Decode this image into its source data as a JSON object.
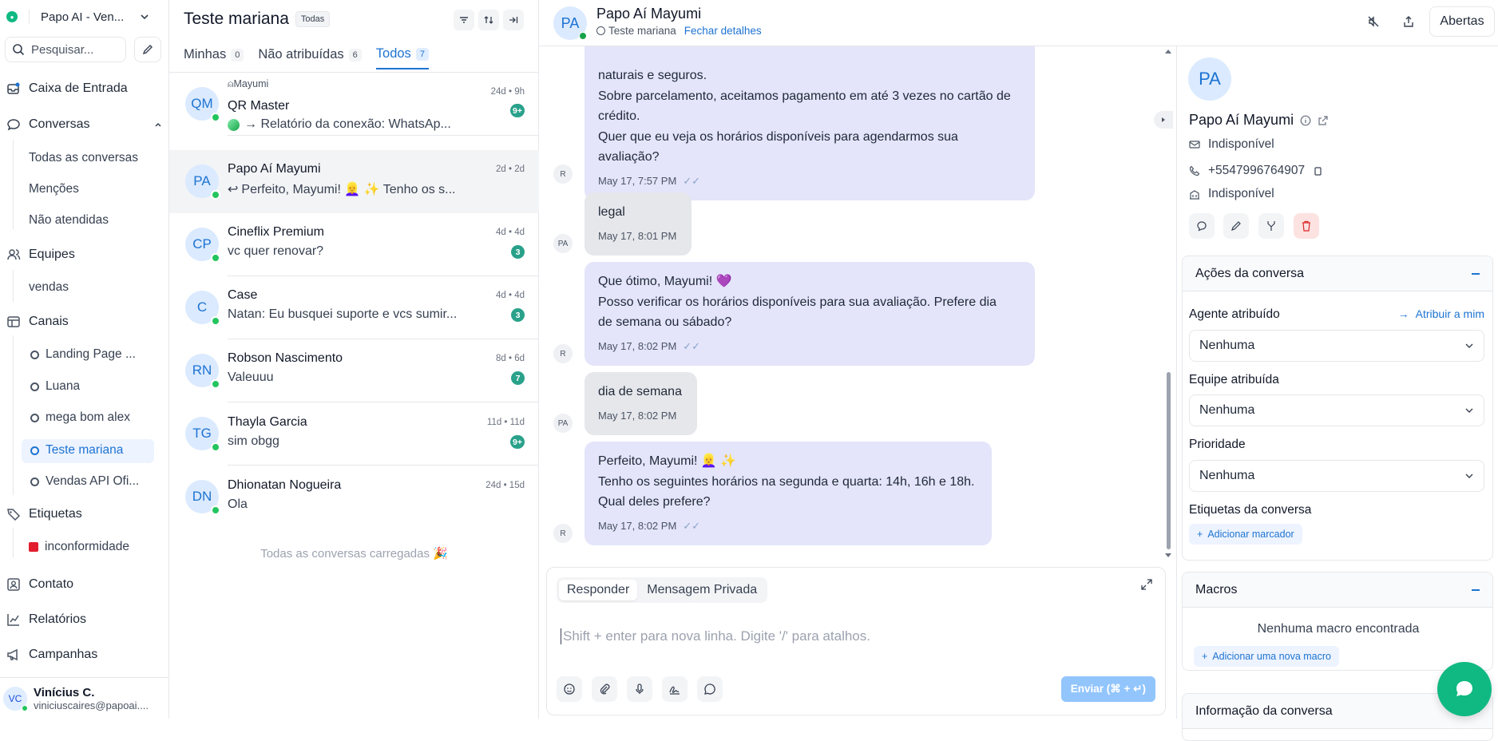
{
  "sidebar": {
    "workspace": "Papo AI - Ven...",
    "search_placeholder": "Pesquisar...",
    "nav": {
      "inbox": "Caixa de Entrada",
      "conversations": "Conversas",
      "all_conversations": "Todas as conversas",
      "mentions": "Menções",
      "unattended": "Não atendidas",
      "teams": "Equipes",
      "team_sales": "vendas",
      "channels": "Canais",
      "channel_items": [
        "Landing Page ...",
        "Luana",
        "mega bom alex",
        "Teste mariana",
        "Vendas API Ofi..."
      ],
      "labels": "Etiquetas",
      "label_items": [
        "inconformidade"
      ],
      "contact": "Contato",
      "reports": "Relatórios",
      "campaigns": "Campanhas"
    },
    "user": {
      "initials": "VC",
      "name": "Vinícius C.",
      "email": "viniciuscaires@papoai...."
    }
  },
  "list": {
    "title": "Teste mariana",
    "filter_chip": "Todas",
    "tabs": [
      {
        "label": "Minhas",
        "count": "0"
      },
      {
        "label": "Não atribuídas",
        "count": "6"
      },
      {
        "label": "Todos",
        "count": "7"
      }
    ],
    "conversations": [
      {
        "initials": "QM",
        "agent": "Mayumi",
        "name": "QR Master",
        "message": "→ Relatório da conexão: WhatsAp...",
        "time": "24d • 9h",
        "unread": "9+"
      },
      {
        "initials": "PA",
        "name": "Papo Aí Mayumi",
        "message": "Perfeito, Mayumi! 👱‍♀️ ✨ Tenho os s...",
        "time": "2d • 2d",
        "unread": ""
      },
      {
        "initials": "CP",
        "name": "Cineflix Premium",
        "message": "vc quer renovar?",
        "time": "4d • 4d",
        "unread": "3"
      },
      {
        "initials": "C",
        "name": "Case",
        "message": "Natan: Eu busquei suporte e vcs sumir...",
        "time": "4d • 4d",
        "unread": "3"
      },
      {
        "initials": "RN",
        "name": "Robson Nascimento",
        "message": "Valeuuu",
        "time": "8d • 6d",
        "unread": "7"
      },
      {
        "initials": "TG",
        "name": "Thayla Garcia",
        "message": "sim obgg",
        "time": "11d • 11d",
        "unread": "9+"
      },
      {
        "initials": "DN",
        "name": "Dhionatan Nogueira",
        "message": "Ola",
        "time": "24d • 15d",
        "unread": ""
      }
    ],
    "loaded_text": "Todas as conversas carregadas 🎉"
  },
  "chat": {
    "contact_initials": "PA",
    "contact_name": "Papo Aí Mayumi",
    "inbox_name": "Teste mariana",
    "close_details": "Fechar detalhes",
    "status_button": "Abertas",
    "messages": [
      {
        "dir": "out",
        "sender": "R",
        "lines": [
          "naturais e seguros.",
          "Sobre parcelamento, aceitamos pagamento em até 3 vezes no cartão de",
          "crédito.",
          "Quer que eu veja os horários disponíveis para agendarmos sua",
          "avaliação?"
        ],
        "time": "May 17, 7:57 PM"
      },
      {
        "dir": "in",
        "sender": "PA",
        "lines": [
          "legal"
        ],
        "time": "May 17, 8:01 PM"
      },
      {
        "dir": "out",
        "sender": "R",
        "lines": [
          "Que ótimo, Mayumi! 💜",
          "Posso verificar os horários disponíveis para sua avaliação. Prefere dia",
          "de semana ou sábado?"
        ],
        "time": "May 17, 8:02 PM"
      },
      {
        "dir": "in",
        "sender": "PA",
        "lines": [
          "dia de semana"
        ],
        "time": "May 17, 8:02 PM"
      },
      {
        "dir": "out",
        "sender": "R",
        "lines": [
          "Perfeito, Mayumi! 👱‍♀️ ✨",
          "Tenho os seguintes horários na segunda e quarta: 14h, 16h e 18h.",
          "Qual deles prefere?"
        ],
        "time": "May 17, 8:02 PM"
      }
    ],
    "composer": {
      "tab_reply": "Responder",
      "tab_private": "Mensagem Privada",
      "placeholder": "Shift + enter para nova linha. Digite '/' para atalhos.",
      "send": "Enviar (⌘ + ↵)"
    }
  },
  "panel": {
    "initials": "PA",
    "name": "Papo Aí Mayumi",
    "email": "Indisponível",
    "phone": "+5547996764907",
    "company": "Indisponível",
    "actions_title": "Ações da conversa",
    "agent_label": "Agente atribuído",
    "assign_me": "Atribuir a mim",
    "agent_value": "Nenhuma",
    "team_label": "Equipe atribuída",
    "team_value": "Nenhuma",
    "priority_label": "Prioridade",
    "priority_value": "Nenhuma",
    "labels_label": "Etiquetas da conversa",
    "add_label": "Adicionar marcador",
    "macros_title": "Macros",
    "no_macros": "Nenhuma macro encontrada",
    "add_macro": "Adicionar uma nova macro",
    "info_title": "Informação da conversa"
  },
  "colors": {
    "accent": "#1d73d1",
    "brand": "#10b981",
    "outgoing_bubble": "#e4e4fb",
    "incoming_bubble": "#e5e7eb",
    "unread_badge": "#2aa18a",
    "label_inconformidade": "#e11d2e"
  }
}
